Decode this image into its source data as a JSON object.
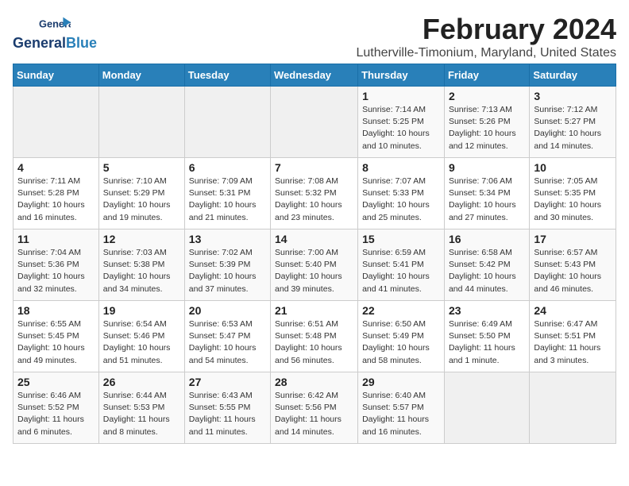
{
  "app": {
    "logo_line1": "General",
    "logo_line2": "Blue"
  },
  "header": {
    "title": "February 2024",
    "subtitle": "Lutherville-Timonium, Maryland, United States"
  },
  "weekdays": [
    "Sunday",
    "Monday",
    "Tuesday",
    "Wednesday",
    "Thursday",
    "Friday",
    "Saturday"
  ],
  "weeks": [
    [
      {
        "day": "",
        "info": ""
      },
      {
        "day": "",
        "info": ""
      },
      {
        "day": "",
        "info": ""
      },
      {
        "day": "",
        "info": ""
      },
      {
        "day": "1",
        "info": "Sunrise: 7:14 AM\nSunset: 5:25 PM\nDaylight: 10 hours\nand 10 minutes."
      },
      {
        "day": "2",
        "info": "Sunrise: 7:13 AM\nSunset: 5:26 PM\nDaylight: 10 hours\nand 12 minutes."
      },
      {
        "day": "3",
        "info": "Sunrise: 7:12 AM\nSunset: 5:27 PM\nDaylight: 10 hours\nand 14 minutes."
      }
    ],
    [
      {
        "day": "4",
        "info": "Sunrise: 7:11 AM\nSunset: 5:28 PM\nDaylight: 10 hours\nand 16 minutes."
      },
      {
        "day": "5",
        "info": "Sunrise: 7:10 AM\nSunset: 5:29 PM\nDaylight: 10 hours\nand 19 minutes."
      },
      {
        "day": "6",
        "info": "Sunrise: 7:09 AM\nSunset: 5:31 PM\nDaylight: 10 hours\nand 21 minutes."
      },
      {
        "day": "7",
        "info": "Sunrise: 7:08 AM\nSunset: 5:32 PM\nDaylight: 10 hours\nand 23 minutes."
      },
      {
        "day": "8",
        "info": "Sunrise: 7:07 AM\nSunset: 5:33 PM\nDaylight: 10 hours\nand 25 minutes."
      },
      {
        "day": "9",
        "info": "Sunrise: 7:06 AM\nSunset: 5:34 PM\nDaylight: 10 hours\nand 27 minutes."
      },
      {
        "day": "10",
        "info": "Sunrise: 7:05 AM\nSunset: 5:35 PM\nDaylight: 10 hours\nand 30 minutes."
      }
    ],
    [
      {
        "day": "11",
        "info": "Sunrise: 7:04 AM\nSunset: 5:36 PM\nDaylight: 10 hours\nand 32 minutes."
      },
      {
        "day": "12",
        "info": "Sunrise: 7:03 AM\nSunset: 5:38 PM\nDaylight: 10 hours\nand 34 minutes."
      },
      {
        "day": "13",
        "info": "Sunrise: 7:02 AM\nSunset: 5:39 PM\nDaylight: 10 hours\nand 37 minutes."
      },
      {
        "day": "14",
        "info": "Sunrise: 7:00 AM\nSunset: 5:40 PM\nDaylight: 10 hours\nand 39 minutes."
      },
      {
        "day": "15",
        "info": "Sunrise: 6:59 AM\nSunset: 5:41 PM\nDaylight: 10 hours\nand 41 minutes."
      },
      {
        "day": "16",
        "info": "Sunrise: 6:58 AM\nSunset: 5:42 PM\nDaylight: 10 hours\nand 44 minutes."
      },
      {
        "day": "17",
        "info": "Sunrise: 6:57 AM\nSunset: 5:43 PM\nDaylight: 10 hours\nand 46 minutes."
      }
    ],
    [
      {
        "day": "18",
        "info": "Sunrise: 6:55 AM\nSunset: 5:45 PM\nDaylight: 10 hours\nand 49 minutes."
      },
      {
        "day": "19",
        "info": "Sunrise: 6:54 AM\nSunset: 5:46 PM\nDaylight: 10 hours\nand 51 minutes."
      },
      {
        "day": "20",
        "info": "Sunrise: 6:53 AM\nSunset: 5:47 PM\nDaylight: 10 hours\nand 54 minutes."
      },
      {
        "day": "21",
        "info": "Sunrise: 6:51 AM\nSunset: 5:48 PM\nDaylight: 10 hours\nand 56 minutes."
      },
      {
        "day": "22",
        "info": "Sunrise: 6:50 AM\nSunset: 5:49 PM\nDaylight: 10 hours\nand 58 minutes."
      },
      {
        "day": "23",
        "info": "Sunrise: 6:49 AM\nSunset: 5:50 PM\nDaylight: 11 hours\nand 1 minute."
      },
      {
        "day": "24",
        "info": "Sunrise: 6:47 AM\nSunset: 5:51 PM\nDaylight: 11 hours\nand 3 minutes."
      }
    ],
    [
      {
        "day": "25",
        "info": "Sunrise: 6:46 AM\nSunset: 5:52 PM\nDaylight: 11 hours\nand 6 minutes."
      },
      {
        "day": "26",
        "info": "Sunrise: 6:44 AM\nSunset: 5:53 PM\nDaylight: 11 hours\nand 8 minutes."
      },
      {
        "day": "27",
        "info": "Sunrise: 6:43 AM\nSunset: 5:55 PM\nDaylight: 11 hours\nand 11 minutes."
      },
      {
        "day": "28",
        "info": "Sunrise: 6:42 AM\nSunset: 5:56 PM\nDaylight: 11 hours\nand 14 minutes."
      },
      {
        "day": "29",
        "info": "Sunrise: 6:40 AM\nSunset: 5:57 PM\nDaylight: 11 hours\nand 16 minutes."
      },
      {
        "day": "",
        "info": ""
      },
      {
        "day": "",
        "info": ""
      }
    ]
  ]
}
